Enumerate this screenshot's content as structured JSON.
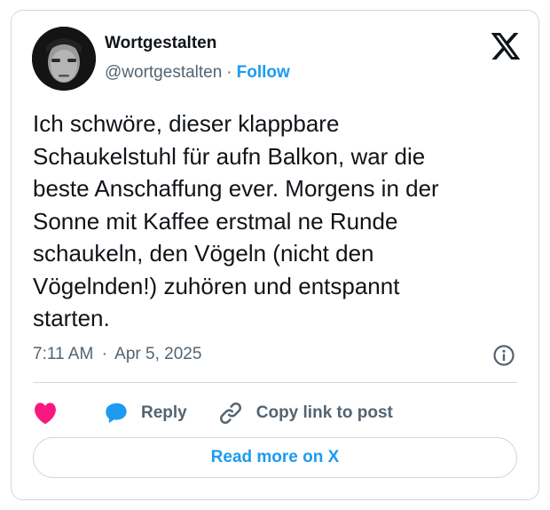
{
  "author": {
    "name": "Wortgestalten",
    "handle": "@wortgestalten",
    "separator": "·",
    "follow_label": "Follow",
    "avatar_icon": "user-avatar"
  },
  "brand": {
    "logo_icon": "x-logo-icon"
  },
  "tweet": {
    "text": "Ich schwöre, dieser klappbare\nSchaukelstuhl für aufn Balkon, war die\nbeste Anschaffung ever. Morgens in der\nSonne mit Kaffee erstmal ne Runde\nschaukeln, den Vögeln (nicht den\nVögelnden!) zuhören und entspannt\nstarten.",
    "time": "7:11 AM",
    "separator": "·",
    "date": "Apr 5, 2025"
  },
  "actions": {
    "like_icon": "heart-icon",
    "reply_label": "Reply",
    "reply_icon": "speech-bubble-icon",
    "copy_label": "Copy link to post",
    "copy_icon": "link-icon"
  },
  "footer": {
    "read_more_label": "Read more on X"
  },
  "colors": {
    "accent": "#1d9bf0",
    "like": "#f91880",
    "text": "#0f1419",
    "muted": "#536471",
    "border": "#cfd9de"
  }
}
